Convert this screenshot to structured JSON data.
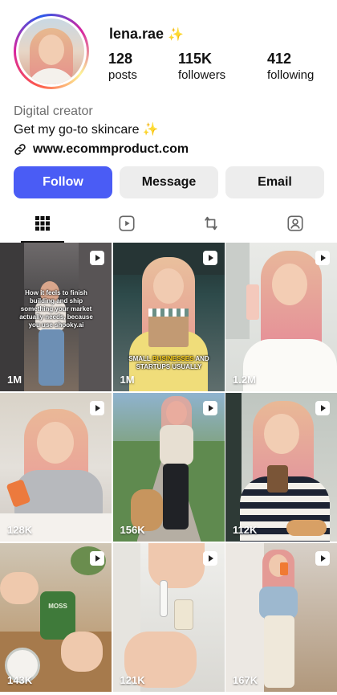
{
  "profile": {
    "username": "lena.rae",
    "username_emoji": "✨",
    "stats": [
      {
        "value": "128",
        "label": "posts"
      },
      {
        "value": "115K",
        "label": "followers"
      },
      {
        "value": "412",
        "label": "following"
      }
    ],
    "category": "Digital creator",
    "bio_text": "Get my go-to skincare",
    "bio_emoji": "✨",
    "link": "www.ecommproduct.com"
  },
  "actions": {
    "follow_label": "Follow",
    "message_label": "Message",
    "email_label": "Email"
  },
  "tabs": [
    {
      "name": "grid-icon",
      "active": true
    },
    {
      "name": "reels-icon",
      "active": false
    },
    {
      "name": "reposts-icon",
      "active": false
    },
    {
      "name": "tagged-icon",
      "active": false
    }
  ],
  "grid": {
    "posts": [
      {
        "views": "1M",
        "caption": "How it feels to finish building and ship something your market actually needs, because you use shooky.ai"
      },
      {
        "views": "1M",
        "caption_part1": "SMALL ",
        "caption_highlight": "BUSINESSES",
        "caption_part2": " AND STARTUPS USUALLY"
      },
      {
        "views": "1.2M"
      },
      {
        "views": "128K"
      },
      {
        "views": "156K"
      },
      {
        "views": "112K"
      },
      {
        "views": "143K",
        "product_label": "MOSS"
      },
      {
        "views": "121K"
      },
      {
        "views": "167K"
      }
    ]
  },
  "colors": {
    "accent": "#4a5cf5",
    "secondary_button": "#ededed",
    "muted_text": "#6e6e6e"
  }
}
